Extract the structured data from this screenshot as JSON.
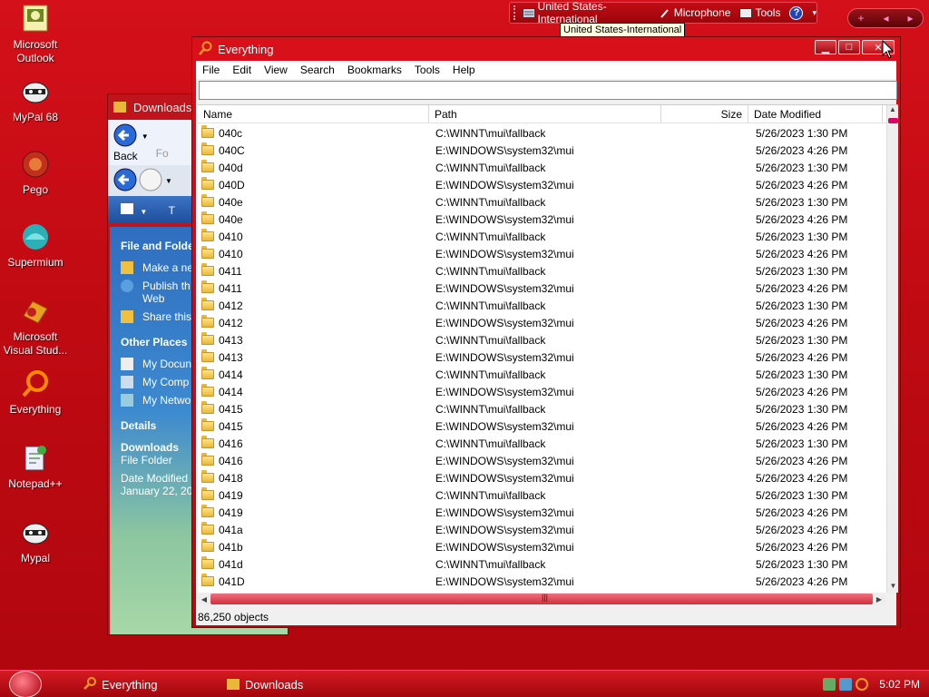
{
  "colors": {
    "desktop_red": "#c00a12",
    "window_red": "#d8101a",
    "accent_orange": "#ff8a00"
  },
  "desktop": {
    "icons": [
      {
        "label": "Microsoft Outlook",
        "icon": "outlook-icon"
      },
      {
        "label": "MyPal 68",
        "icon": "raccoon-icon"
      },
      {
        "label": "Pego",
        "icon": "pego-icon"
      },
      {
        "label": "Supermium",
        "icon": "supermium-icon"
      },
      {
        "label": "Microsoft Visual Stud...",
        "icon": "visual-studio-icon"
      },
      {
        "label": "Everything",
        "icon": "everything-icon"
      },
      {
        "label": "Notepad++",
        "icon": "notepad-plus-icon"
      },
      {
        "label": "Mypal",
        "icon": "raccoon-icon"
      }
    ]
  },
  "langbar": {
    "language": "United States-International",
    "microphone": "Microphone",
    "tools": "Tools",
    "help": "?",
    "tooltip": "United States-International"
  },
  "pill": {
    "plus": "+",
    "prev": "◂",
    "next": "▸"
  },
  "explorer": {
    "title": "Downloads",
    "back_label": "Back",
    "forward_label": "Fo",
    "view_label": "T",
    "file_tasks_title": "File and Folder",
    "file_tasks": [
      "Make a ne",
      "Publish th Web",
      "Share this"
    ],
    "other_places_title": "Other Places",
    "other_places": [
      "My Docun",
      "My Comp",
      "My Netwo"
    ],
    "details_title": "Details",
    "details_name": "Downloads",
    "details_type": "File Folder",
    "details_date_label": "Date Modified",
    "details_date": "January 22, 202"
  },
  "everything": {
    "title": "Everything",
    "window_buttons": {
      "minimize": "▁",
      "maximize": "□",
      "close": "✕"
    },
    "menu": [
      "File",
      "Edit",
      "View",
      "Search",
      "Bookmarks",
      "Tools",
      "Help"
    ],
    "search_value": "",
    "columns": {
      "name": "Name",
      "path": "Path",
      "size": "Size",
      "date": "Date Modified"
    },
    "rows": [
      {
        "name": "040c",
        "path": "C:\\WINNT\\mui\\fallback",
        "size": "",
        "date": "5/26/2023 1:30 PM"
      },
      {
        "name": "040C",
        "path": "E:\\WINDOWS\\system32\\mui",
        "size": "",
        "date": "5/26/2023 4:26 PM"
      },
      {
        "name": "040d",
        "path": "C:\\WINNT\\mui\\fallback",
        "size": "",
        "date": "5/26/2023 1:30 PM"
      },
      {
        "name": "040D",
        "path": "E:\\WINDOWS\\system32\\mui",
        "size": "",
        "date": "5/26/2023 4:26 PM"
      },
      {
        "name": "040e",
        "path": "C:\\WINNT\\mui\\fallback",
        "size": "",
        "date": "5/26/2023 1:30 PM"
      },
      {
        "name": "040e",
        "path": "E:\\WINDOWS\\system32\\mui",
        "size": "",
        "date": "5/26/2023 4:26 PM"
      },
      {
        "name": "0410",
        "path": "C:\\WINNT\\mui\\fallback",
        "size": "",
        "date": "5/26/2023 1:30 PM"
      },
      {
        "name": "0410",
        "path": "E:\\WINDOWS\\system32\\mui",
        "size": "",
        "date": "5/26/2023 4:26 PM"
      },
      {
        "name": "0411",
        "path": "C:\\WINNT\\mui\\fallback",
        "size": "",
        "date": "5/26/2023 1:30 PM"
      },
      {
        "name": "0411",
        "path": "E:\\WINDOWS\\system32\\mui",
        "size": "",
        "date": "5/26/2023 4:26 PM"
      },
      {
        "name": "0412",
        "path": "C:\\WINNT\\mui\\fallback",
        "size": "",
        "date": "5/26/2023 1:30 PM"
      },
      {
        "name": "0412",
        "path": "E:\\WINDOWS\\system32\\mui",
        "size": "",
        "date": "5/26/2023 4:26 PM"
      },
      {
        "name": "0413",
        "path": "C:\\WINNT\\mui\\fallback",
        "size": "",
        "date": "5/26/2023 1:30 PM"
      },
      {
        "name": "0413",
        "path": "E:\\WINDOWS\\system32\\mui",
        "size": "",
        "date": "5/26/2023 4:26 PM"
      },
      {
        "name": "0414",
        "path": "C:\\WINNT\\mui\\fallback",
        "size": "",
        "date": "5/26/2023 1:30 PM"
      },
      {
        "name": "0414",
        "path": "E:\\WINDOWS\\system32\\mui",
        "size": "",
        "date": "5/26/2023 4:26 PM"
      },
      {
        "name": "0415",
        "path": "C:\\WINNT\\mui\\fallback",
        "size": "",
        "date": "5/26/2023 1:30 PM"
      },
      {
        "name": "0415",
        "path": "E:\\WINDOWS\\system32\\mui",
        "size": "",
        "date": "5/26/2023 4:26 PM"
      },
      {
        "name": "0416",
        "path": "C:\\WINNT\\mui\\fallback",
        "size": "",
        "date": "5/26/2023 1:30 PM"
      },
      {
        "name": "0416",
        "path": "E:\\WINDOWS\\system32\\mui",
        "size": "",
        "date": "5/26/2023 4:26 PM"
      },
      {
        "name": "0418",
        "path": "E:\\WINDOWS\\system32\\mui",
        "size": "",
        "date": "5/26/2023 4:26 PM"
      },
      {
        "name": "0419",
        "path": "C:\\WINNT\\mui\\fallback",
        "size": "",
        "date": "5/26/2023 1:30 PM"
      },
      {
        "name": "0419",
        "path": "E:\\WINDOWS\\system32\\mui",
        "size": "",
        "date": "5/26/2023 4:26 PM"
      },
      {
        "name": "041a",
        "path": "E:\\WINDOWS\\system32\\mui",
        "size": "",
        "date": "5/26/2023 4:26 PM"
      },
      {
        "name": "041b",
        "path": "E:\\WINDOWS\\system32\\mui",
        "size": "",
        "date": "5/26/2023 4:26 PM"
      },
      {
        "name": "041d",
        "path": "C:\\WINNT\\mui\\fallback",
        "size": "",
        "date": "5/26/2023 1:30 PM"
      },
      {
        "name": "041D",
        "path": "E:\\WINDOWS\\system32\\mui",
        "size": "",
        "date": "5/26/2023 4:26 PM"
      }
    ],
    "status": "86,250 objects"
  },
  "taskbar": {
    "buttons": [
      {
        "label": "Everything",
        "icon": "everything-icon"
      },
      {
        "label": "Downloads",
        "icon": "folder-icon"
      }
    ],
    "clock": "5:02 PM"
  }
}
